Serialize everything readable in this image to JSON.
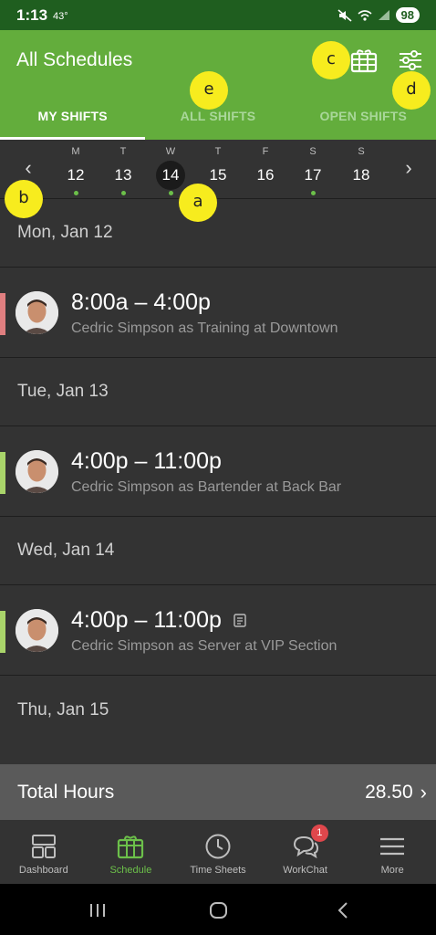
{
  "status_bar": {
    "time": "1:13",
    "temp": "43°",
    "battery": "98"
  },
  "header": {
    "title": "All Schedules"
  },
  "tabs": [
    {
      "label": "MY SHIFTS",
      "active": true
    },
    {
      "label": "ALL SHIFTS",
      "active": false
    },
    {
      "label": "OPEN SHIFTS",
      "active": false
    }
  ],
  "week": {
    "days": [
      {
        "letter": "M",
        "num": "12",
        "has_shift": true
      },
      {
        "letter": "T",
        "num": "13",
        "has_shift": true
      },
      {
        "letter": "W",
        "num": "14",
        "has_shift": true,
        "selected": true
      },
      {
        "letter": "T",
        "num": "15",
        "has_shift": false
      },
      {
        "letter": "F",
        "num": "16",
        "has_shift": false
      },
      {
        "letter": "S",
        "num": "17",
        "has_shift": true
      },
      {
        "letter": "S",
        "num": "18",
        "has_shift": false
      }
    ]
  },
  "schedule": {
    "groups": [
      {
        "date": "Mon, Jan 12",
        "shift": {
          "time": "8:00a – 4:00p",
          "desc": "Cedric Simpson as Training at Downtown",
          "color": "#e07f80",
          "has_note": false
        }
      },
      {
        "date": "Tue, Jan 13",
        "shift": {
          "time": "4:00p – 11:00p",
          "desc": "Cedric Simpson as Bartender at Back Bar",
          "color": "#a9d46a",
          "has_note": false
        }
      },
      {
        "date": "Wed, Jan 14",
        "shift": {
          "time": "4:00p – 11:00p",
          "desc": "Cedric Simpson as Server at VIP Section",
          "color": "#a9d46a",
          "has_note": true
        }
      },
      {
        "date": "Thu, Jan 15"
      }
    ]
  },
  "total": {
    "label": "Total Hours",
    "value": "28.50"
  },
  "bottom_nav": [
    {
      "label": "Dashboard",
      "icon": "dashboard-icon"
    },
    {
      "label": "Schedule",
      "icon": "schedule-icon",
      "active": true
    },
    {
      "label": "Time Sheets",
      "icon": "clock-icon"
    },
    {
      "label": "WorkChat",
      "icon": "chat-icon",
      "badge": "1"
    },
    {
      "label": "More",
      "icon": "menu-icon"
    }
  ],
  "annotations": [
    "a",
    "b",
    "c",
    "d",
    "e"
  ],
  "colors": {
    "header_green": "#63ad3c",
    "status_green": "#1f5e1f",
    "accent_green": "#6cc04a",
    "badge_red": "#e0474c",
    "marker_yellow": "#f7ec1e"
  }
}
